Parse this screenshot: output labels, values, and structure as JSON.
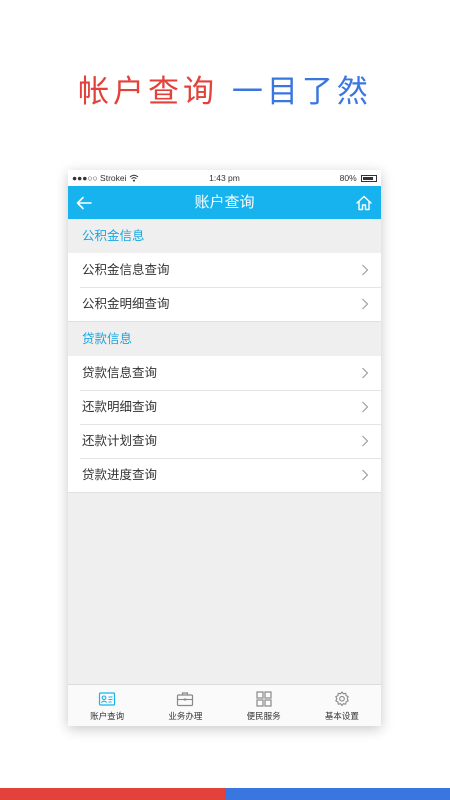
{
  "banner": {
    "part1": "帐户查询",
    "part2": "一目了然",
    "color1": "#e2423a",
    "color2": "#3a76e0"
  },
  "status_bar": {
    "carrier": "●●●○○ Strokei",
    "time": "1:43 pm",
    "battery": "80%",
    "battery_level": 0.8
  },
  "nav": {
    "title": "账户查询",
    "back_icon": "back-arrow-icon",
    "home_icon": "home-icon",
    "color": "#16b3ef"
  },
  "sections": [
    {
      "header": "公积金信息",
      "items": [
        "公积金信息查询",
        "公积金明细查询"
      ]
    },
    {
      "header": "贷款信息",
      "items": [
        "贷款信息查询",
        "还款明细查询",
        "还款计划查询",
        "贷款进度查询"
      ]
    }
  ],
  "tabbar": {
    "tabs": [
      {
        "label": "账户查询",
        "icon": "id-card-icon"
      },
      {
        "label": "业务办理",
        "icon": "briefcase-icon"
      },
      {
        "label": "便民服务",
        "icon": "grid-icon"
      },
      {
        "label": "基本设置",
        "icon": "gear-icon"
      }
    ]
  },
  "footer_bar": {
    "left_color": "#e2423a",
    "right_color": "#3a76e0"
  }
}
